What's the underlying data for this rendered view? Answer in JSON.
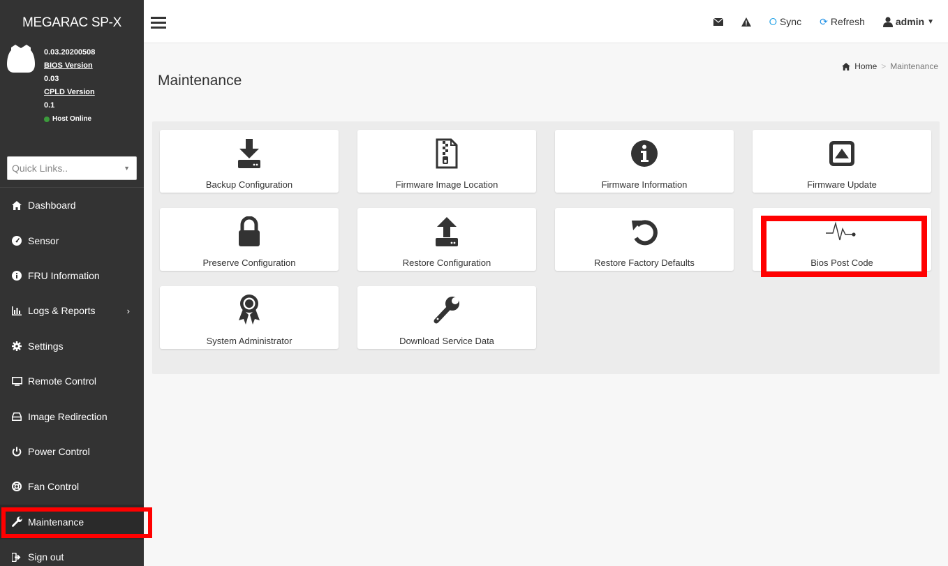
{
  "brand": "MEGARAC SP-X",
  "user_panel": {
    "version": "0.03.20200508",
    "bios_label": "BIOS Version",
    "bios_value": "0.03",
    "cpld_label": "CPLD Version",
    "cpld_value": "0.1",
    "host_status": "Host Online"
  },
  "quick_links": {
    "placeholder": "Quick Links.."
  },
  "sidebar": {
    "items": [
      {
        "label": "Dashboard",
        "icon": "home-icon"
      },
      {
        "label": "Sensor",
        "icon": "dashboard-gauge-icon"
      },
      {
        "label": "FRU Information",
        "icon": "info-circle-icon"
      },
      {
        "label": "Logs & Reports",
        "icon": "bar-chart-icon"
      },
      {
        "label": "Settings",
        "icon": "gear-icon"
      },
      {
        "label": "Remote Control",
        "icon": "monitor-icon"
      },
      {
        "label": "Image Redirection",
        "icon": "drive-icon"
      },
      {
        "label": "Power Control",
        "icon": "power-icon"
      },
      {
        "label": "Fan Control",
        "icon": "fan-icon"
      },
      {
        "label": "Maintenance",
        "icon": "wrench-icon"
      },
      {
        "label": "Sign out",
        "icon": "sign-out-icon"
      }
    ]
  },
  "topbar": {
    "sync_label": "Sync",
    "refresh_label": "Refresh",
    "user_label": "admin"
  },
  "page": {
    "title": "Maintenance"
  },
  "breadcrumb": {
    "home": "Home",
    "sep": ">",
    "current": "Maintenance"
  },
  "tiles": [
    {
      "label": "Backup Configuration",
      "icon": "download-icon"
    },
    {
      "label": "Firmware Image Location",
      "icon": "file-zip-icon"
    },
    {
      "label": "Firmware Information",
      "icon": "info-icon"
    },
    {
      "label": "Firmware Update",
      "icon": "upload-square-icon"
    },
    {
      "label": "Preserve Configuration",
      "icon": "lock-icon"
    },
    {
      "label": "Restore Configuration",
      "icon": "upload-icon"
    },
    {
      "label": "Restore Factory Defaults",
      "icon": "undo-icon"
    },
    {
      "label": "Bios Post Code",
      "icon": "pulse-icon"
    },
    {
      "label": "System Administrator",
      "icon": "award-icon"
    },
    {
      "label": "Download Service Data",
      "icon": "wrench-icon"
    }
  ],
  "colors": {
    "sidebar_bg": "#333333",
    "highlight": "#ff0000",
    "accent": "#1e90e6"
  }
}
